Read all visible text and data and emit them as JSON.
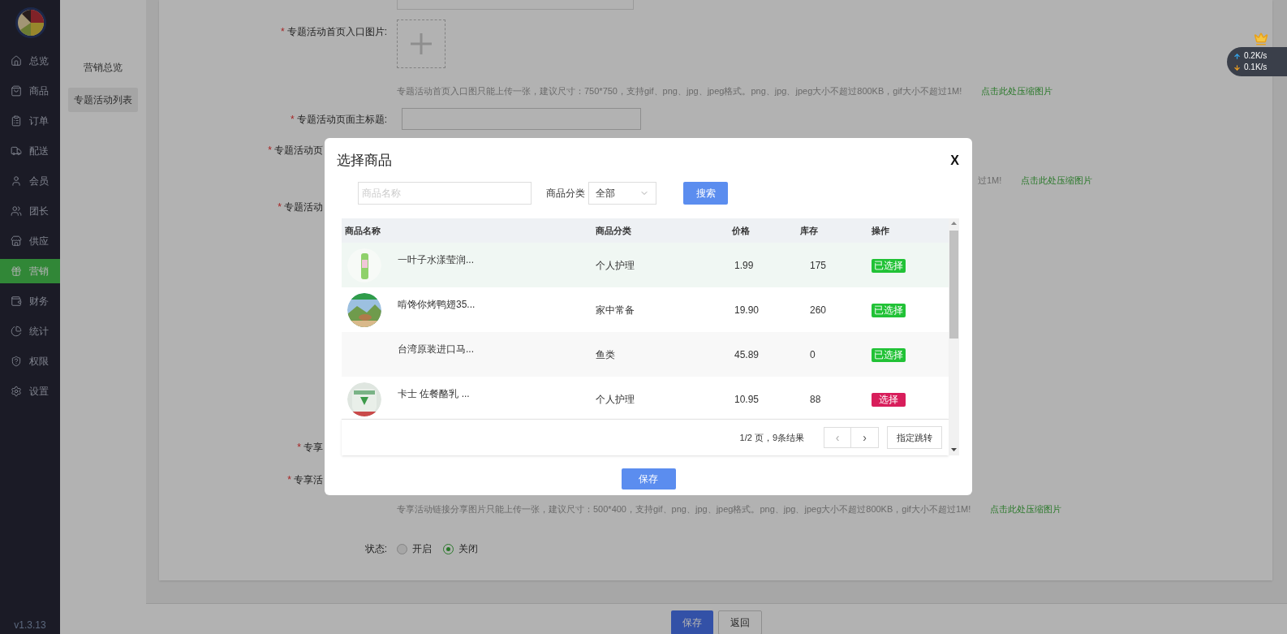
{
  "sidebar": {
    "items": [
      {
        "label": "总览",
        "selected": false
      },
      {
        "label": "商品",
        "selected": false
      },
      {
        "label": "订单",
        "selected": false
      },
      {
        "label": "配送",
        "selected": false
      },
      {
        "label": "会员",
        "selected": false
      },
      {
        "label": "团长",
        "selected": false
      },
      {
        "label": "供应",
        "selected": false
      },
      {
        "label": "营销",
        "selected": true
      },
      {
        "label": "财务",
        "selected": false
      },
      {
        "label": "统计",
        "selected": false
      },
      {
        "label": "权限",
        "selected": false
      },
      {
        "label": "设置",
        "selected": false
      }
    ],
    "version": "v1.3.13"
  },
  "subnav": {
    "items": [
      {
        "label": "营销总览",
        "selected": false
      },
      {
        "label": "专题活动列表",
        "selected": true
      }
    ]
  },
  "form": {
    "rows": [
      {
        "kind": "edge"
      },
      {
        "kind": "upload",
        "label": "专题活动首页入口图片:",
        "required": "*"
      },
      {
        "kind": "hint",
        "text": "专题活动首页入口图只能上传一张，建议尺寸：750*750，支持gif、png、jpg、jpeg格式。png、jpg、jpeg大小不超过800KB，gif大小不超过1M!",
        "link": "点击此处压缩图片"
      },
      {
        "kind": "input",
        "label": "专题活动页面主标题:",
        "required": "*"
      },
      {
        "kind": "partial",
        "label": "专题活动页",
        "required": "*"
      },
      {
        "kind": "tail",
        "text": "过1M!",
        "link": "点击此处压缩图片"
      },
      {
        "kind": "partial",
        "label": "专题活动",
        "required": "*"
      },
      {
        "kind": "partial",
        "label": "专享",
        "required": "*"
      },
      {
        "kind": "partial",
        "label": "专享活",
        "required": "*"
      },
      {
        "kind": "hint",
        "text": "专享活动链接分享图片只能上传一张，建议尺寸：500*400，支持gif、png、jpg、jpeg格式。png、jpg、jpeg大小不超过800KB，gif大小不超过1M!",
        "link": "点击此处压缩图片"
      },
      {
        "kind": "radio",
        "label": "状态:",
        "options": [
          {
            "label": "开启",
            "selected": false
          },
          {
            "label": "关闭",
            "selected": true
          }
        ]
      }
    ]
  },
  "footer": {
    "buttons": [
      {
        "label": "保存",
        "kind": "primary"
      },
      {
        "label": "返回",
        "kind": "default"
      }
    ]
  },
  "net_speed": {
    "up": "0.2K/s",
    "down": "0.1K/s"
  },
  "modal": {
    "title": "选择商品",
    "close": "X",
    "search": {
      "placeholder": "商品名称"
    },
    "category_label": "商品分类",
    "category_value": "全部",
    "search_button": "搜索",
    "table": {
      "columns": [
        "商品名称",
        "商品分类",
        "价格",
        "库存",
        "操作"
      ],
      "rows": [
        {
          "picture": true,
          "highlighted": true,
          "name": "一叶子水漾莹润...",
          "category": "个人护理",
          "price": "1.99",
          "stock": "175",
          "action": "已选择",
          "selected": true
        },
        {
          "picture": true,
          "highlighted": false,
          "name": "啃馋你烤鸭翅35...",
          "category": "家中常备",
          "price": "19.90",
          "stock": "260",
          "action": "已选择",
          "selected": true
        },
        {
          "picture": false,
          "highlighted": false,
          "name": "台湾原装进口马...",
          "category": "鱼类",
          "price": "45.89",
          "stock": "0",
          "action": "已选择",
          "selected": true
        },
        {
          "picture": true,
          "highlighted": false,
          "name": "卡士 佐餐酪乳 ...",
          "category": "个人护理",
          "price": "10.95",
          "stock": "88",
          "action": "选择",
          "selected": false
        }
      ]
    },
    "pagination": {
      "summary": "1/2 页，9条结果",
      "prev": "‹",
      "next": "›",
      "jump": "指定跳转"
    },
    "save": "保存"
  }
}
